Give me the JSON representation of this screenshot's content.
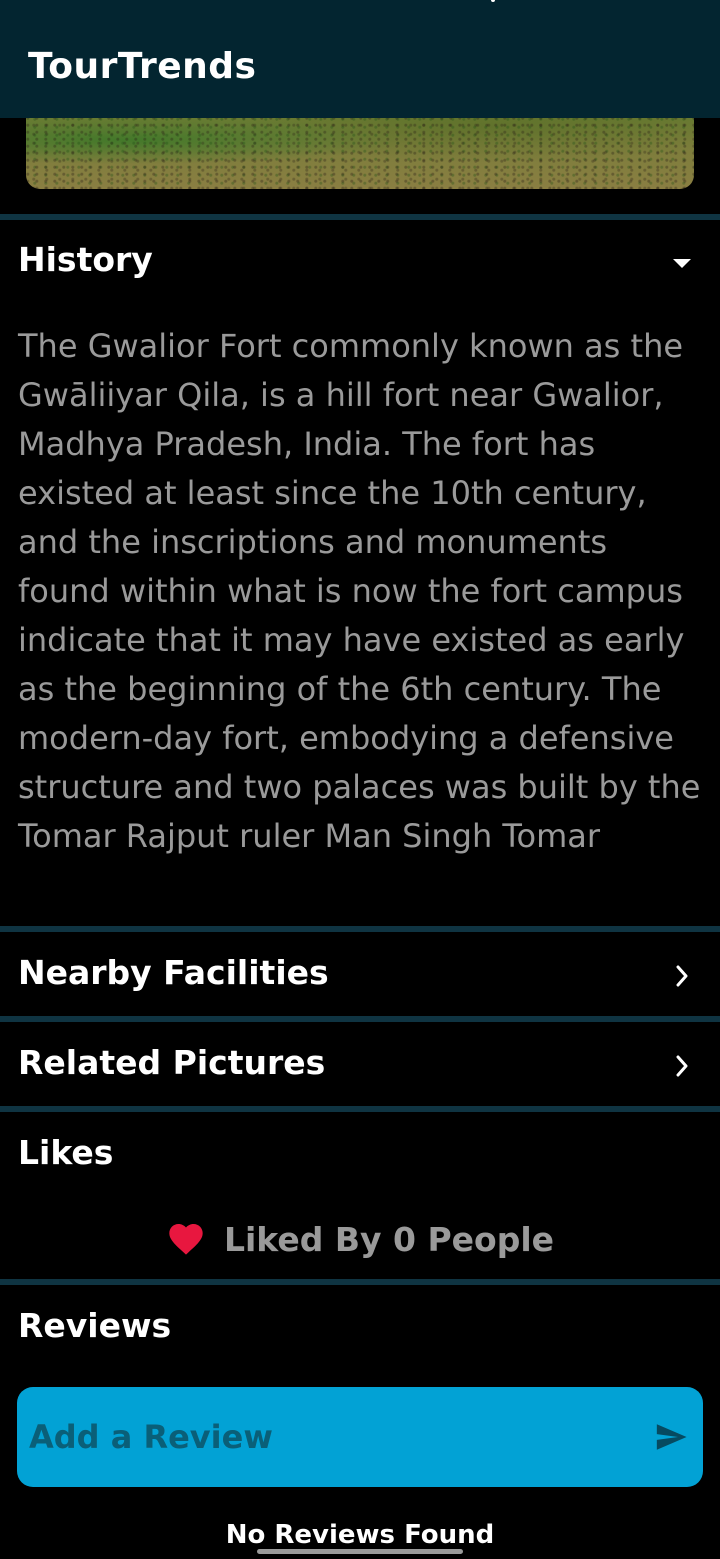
{
  "app": {
    "title": "TourTrends"
  },
  "sections": {
    "history": {
      "label": "History",
      "body": "The Gwalior Fort commonly known as the Gwāliiyar Qila, is a hill fort near Gwalior, Madhya Pradesh, India. The fort has existed at least since the 10th century, and the inscriptions and monuments found within what is now the fort campus indicate that it may have existed as early as the beginning of the 6th century. The modern-day fort, embodying a defensive structure and two palaces was built by the Tomar Rajput ruler Man Singh Tomar"
    },
    "nearby": {
      "label": "Nearby Facilities"
    },
    "pictures": {
      "label": "Related Pictures"
    },
    "likes": {
      "label": "Likes",
      "count_text": "Liked By 0 People"
    },
    "reviews": {
      "label": "Reviews",
      "input_placeholder": "Add a Review",
      "empty_text": "No Reviews Found"
    }
  },
  "colors": {
    "app_bar": "#032530",
    "divider": "#0f3442",
    "accent": "#02a2d5",
    "heart": "#e8173f",
    "muted_text": "#9a9a9a"
  },
  "icons": {
    "history_toggle": "caret-down-icon",
    "nearby_toggle": "chevron-right-icon",
    "pictures_toggle": "chevron-right-icon",
    "like": "heart-icon",
    "send": "send-icon"
  }
}
